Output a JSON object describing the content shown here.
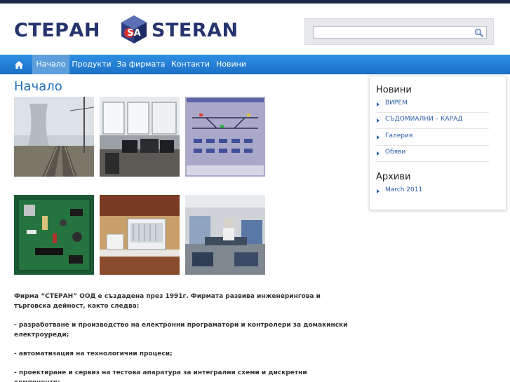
{
  "header": {
    "logo_word_left": "СТЕРАН",
    "logo_word_right": "STERAN",
    "logo_mark_text": "SA",
    "brand_color": "#26346e"
  },
  "search": {
    "placeholder": "",
    "value": ""
  },
  "nav": {
    "home_icon": "home-icon",
    "items": [
      {
        "label": "Начало",
        "active": true
      },
      {
        "label": "Продукти"
      },
      {
        "label": "За фирмата"
      },
      {
        "label": "Контакти"
      },
      {
        "label": "Новини"
      }
    ],
    "bar_color": "#1f78d1"
  },
  "main": {
    "title": "Начало",
    "images": [
      "railway-power-plant-photo",
      "control-room-photo",
      "track-diagram-screen",
      "circuit-board-photo",
      "lab-appliance-photo",
      "workshop-photo"
    ],
    "paragraphs": [
      "Фирма “СТЕРАН” ООД е създадена през 1991г. Фирмата развива инженерингова и търговска дейност, както следва:",
      "-        разработване и производство на електронни програматори и контролери за домакински електроуреди;",
      "-        автоматизация на технологични процеси;",
      "-        проектиране и сервиз на тестова апаратура за интегрални схеми и дискретни компоненти;"
    ]
  },
  "sidebar": {
    "news_heading": "Новини",
    "news_items": [
      "ВИРЕМ",
      "СЪДОМИАЛНИ – КАРАД",
      "Галерия",
      "Обяви"
    ],
    "archive_heading": "Архиви",
    "archive_items": [
      "March 2011"
    ]
  }
}
